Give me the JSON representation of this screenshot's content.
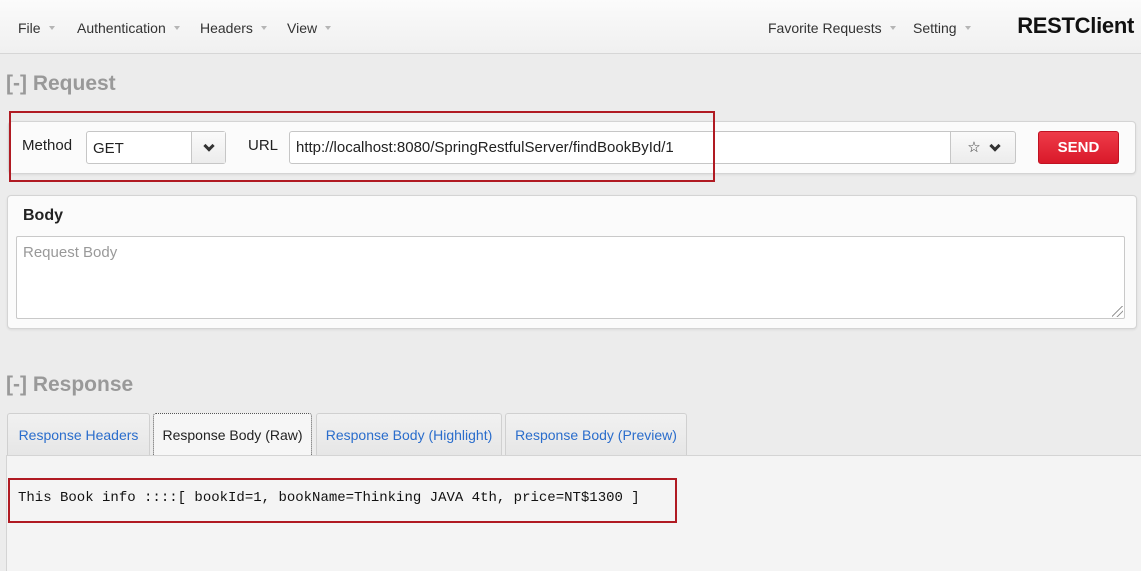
{
  "navbar": {
    "menus": [
      {
        "label": "File"
      },
      {
        "label": "Authentication"
      },
      {
        "label": "Headers"
      },
      {
        "label": "View"
      }
    ],
    "right_menus": [
      {
        "label": "Favorite Requests"
      },
      {
        "label": "Setting"
      }
    ],
    "brand": "RESTClient"
  },
  "request": {
    "section_title": "[-] Request",
    "method_label": "Method",
    "method_value": "GET",
    "url_label": "URL",
    "url_value": "http://localhost:8080/SpringRestfulServer/findBookById/1",
    "send_label": "SEND",
    "body_title": "Body",
    "body_placeholder": "Request Body"
  },
  "response": {
    "section_title": "[-] Response",
    "tabs": [
      {
        "label": "Response Headers",
        "active": false
      },
      {
        "label": "Response Body (Raw)",
        "active": true
      },
      {
        "label": "Response Body (Highlight)",
        "active": false
      },
      {
        "label": "Response Body (Preview)",
        "active": false
      }
    ],
    "body_text": "This Book info ::::[ bookId=1, bookName=Thinking JAVA 4th, price=NT$1300 ]"
  },
  "colors": {
    "send_button": "#e32636",
    "link_tab": "#2a6dcc",
    "highlight_box": "#b01a22"
  },
  "icons": {
    "favorite": "star-icon",
    "dropdown": "chevron-down-icon"
  }
}
